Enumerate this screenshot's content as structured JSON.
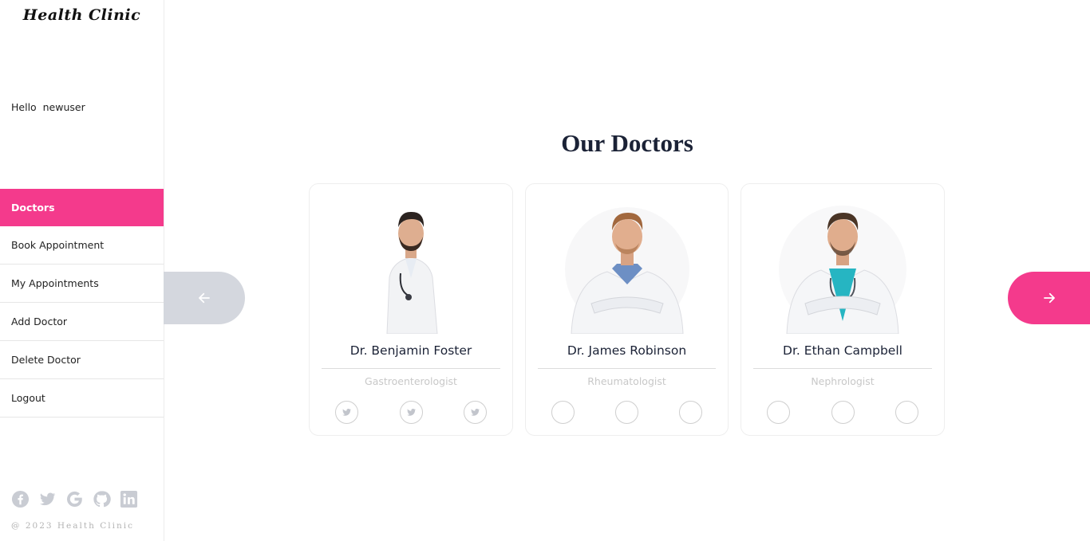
{
  "sidebar": {
    "brand": "Health Clinic",
    "greeting": "Hello  newuser",
    "items": [
      {
        "label": "Doctors",
        "active": true
      },
      {
        "label": "Book Appointment"
      },
      {
        "label": "My Appointments"
      },
      {
        "label": "Add Doctor"
      },
      {
        "label": "Delete Doctor"
      },
      {
        "label": "Logout"
      }
    ],
    "socials": [
      "facebook-icon",
      "twitter-icon",
      "google-icon",
      "github-icon",
      "linkedin-icon"
    ],
    "copyright": "@ 2023 Health Clinic"
  },
  "main": {
    "title": "Our Doctors",
    "doctors": [
      {
        "name": "Dr. Benjamin Foster",
        "specialty": "Gastroenterologist",
        "social_icons": [
          "twitter-icon",
          "twitter-icon",
          "twitter-icon"
        ]
      },
      {
        "name": "Dr. James Robinson",
        "specialty": "Rheumatologist",
        "social_icons": [
          "",
          "",
          ""
        ]
      },
      {
        "name": "Dr. Ethan Campbell",
        "specialty": "Nephrologist",
        "social_icons": [
          "",
          "",
          ""
        ]
      }
    ],
    "prev_icon": "arrow-left-icon",
    "next_icon": "arrow-right-icon"
  },
  "colors": {
    "accent": "#f43a8c",
    "arrow_inactive": "#d4d7de",
    "title": "#1b2236",
    "muted": "#c8c8c8"
  }
}
